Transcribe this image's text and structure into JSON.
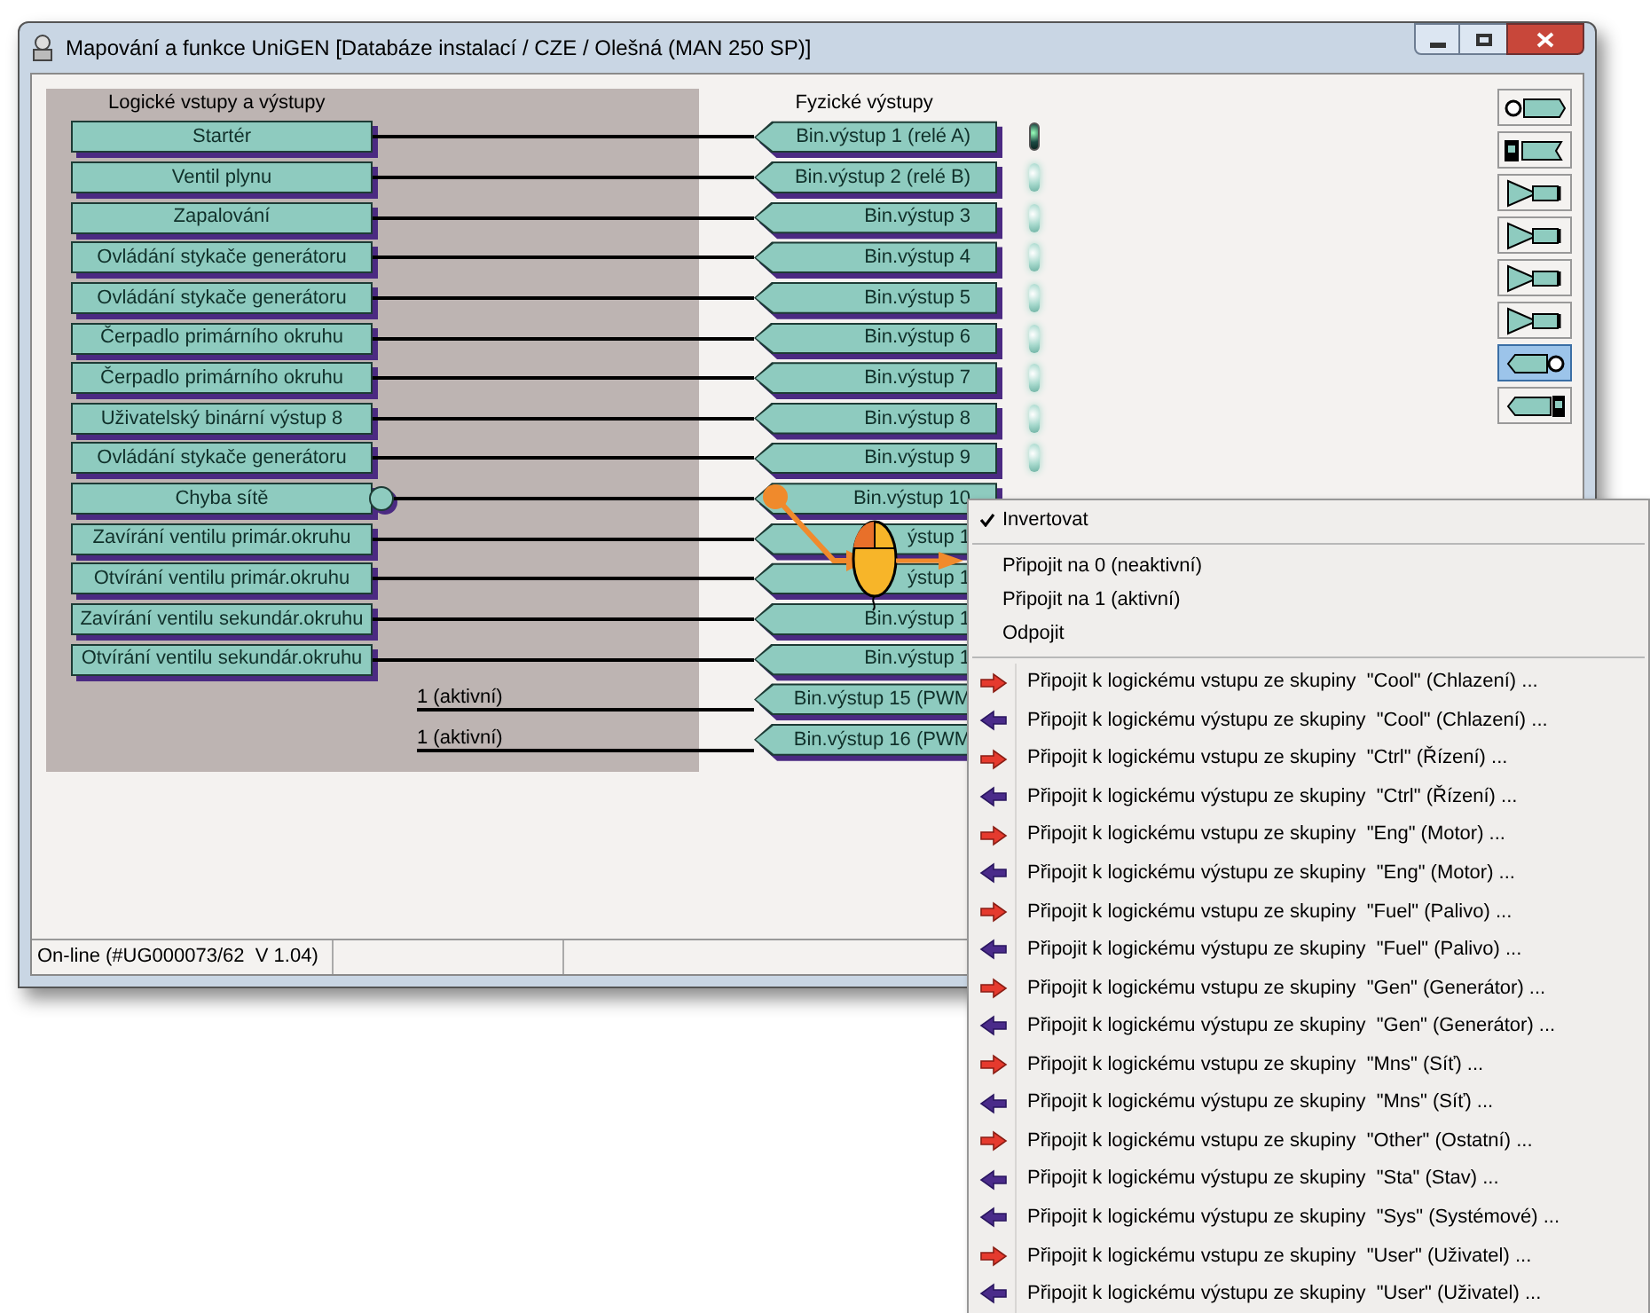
{
  "window": {
    "title": "Mapování a funkce UniGEN [Databáze instalací / CZE / Olešná (MAN 250 SP)]"
  },
  "headers": {
    "logical": "Logické vstupy a výstupy",
    "physical": "Fyzické výstupy"
  },
  "rows": [
    {
      "kind": "signal",
      "source": "Startér",
      "inverted": false,
      "output": "Bin.výstup 1 (relé A)",
      "led_on": true
    },
    {
      "kind": "signal",
      "source": "Ventil plynu",
      "inverted": false,
      "output": "Bin.výstup 2 (relé B)",
      "led_on": false
    },
    {
      "kind": "signal",
      "source": "Zapalování",
      "inverted": false,
      "output": "Bin.výstup 3",
      "led_on": false
    },
    {
      "kind": "signal",
      "source": "Ovládání stykače generátoru",
      "inverted": false,
      "output": "Bin.výstup 4",
      "led_on": false
    },
    {
      "kind": "signal",
      "source": "Ovládání stykače generátoru",
      "inverted": false,
      "output": "Bin.výstup 5",
      "led_on": false
    },
    {
      "kind": "signal",
      "source": "Čerpadlo primárního okruhu",
      "inverted": false,
      "output": "Bin.výstup 6",
      "led_on": false
    },
    {
      "kind": "signal",
      "source": "Čerpadlo primárního okruhu",
      "inverted": false,
      "output": "Bin.výstup 7",
      "led_on": false
    },
    {
      "kind": "signal",
      "source": "Uživatelský binární výstup 8",
      "inverted": false,
      "output": "Bin.výstup 8",
      "led_on": false
    },
    {
      "kind": "signal",
      "source": "Ovládání stykače generátoru",
      "inverted": false,
      "output": "Bin.výstup 9",
      "led_on": false
    },
    {
      "kind": "signal",
      "source": "Chyba sítě",
      "inverted": true,
      "output": "Bin.výstup 10"
    },
    {
      "kind": "signal",
      "source": "Zavírání ventilu primár.okruhu",
      "inverted": false,
      "output": "ýstup 1"
    },
    {
      "kind": "signal",
      "source": "Otvírání ventilu primár.okruhu",
      "inverted": false,
      "output": "ýstup 1"
    },
    {
      "kind": "signal",
      "source": "Zavírání ventilu sekundár.okruhu",
      "inverted": false,
      "output": "Bin.výstup 1"
    },
    {
      "kind": "signal",
      "source": "Otvírání ventilu sekundár.okruhu",
      "inverted": false,
      "output": "Bin.výstup 1"
    },
    {
      "kind": "constant",
      "source": "1 (aktivní)",
      "output": "Bin.výstup 15 (PWM"
    },
    {
      "kind": "constant",
      "source": "1 (aktivní)",
      "output": "Bin.výstup 16 (PWM"
    }
  ],
  "toolbar": [
    {
      "kind": "led-in",
      "selected": false
    },
    {
      "kind": "gauge",
      "selected": false
    },
    {
      "kind": "amp1",
      "selected": false
    },
    {
      "kind": "amp2",
      "selected": false
    },
    {
      "kind": "amp3",
      "selected": false
    },
    {
      "kind": "amp4",
      "selected": false
    },
    {
      "kind": "out-led",
      "selected": true
    },
    {
      "kind": "gauge-out",
      "selected": false
    }
  ],
  "status_bar": [
    "On-line (#UG000073/62  V 1.04)"
  ],
  "context_menu": {
    "items": [
      {
        "kind": "check",
        "label": "Invertovat",
        "checked": true
      },
      {
        "kind": "separator"
      },
      {
        "kind": "plain",
        "label": "Připojit na 0 (neaktivní)"
      },
      {
        "kind": "plain",
        "label": "Připojit na 1 (aktivní)"
      },
      {
        "kind": "plain",
        "label": "Odpojit"
      },
      {
        "kind": "separator"
      },
      {
        "kind": "in",
        "label": "Připojit k logickému vstupu ze skupiny  \"Cool\" (Chlazení) ..."
      },
      {
        "kind": "out",
        "label": "Připojit k logickému výstupu ze skupiny  \"Cool\" (Chlazení) ..."
      },
      {
        "kind": "in",
        "label": "Připojit k logickému vstupu ze skupiny  \"Ctrl\" (Řízení) ..."
      },
      {
        "kind": "out",
        "label": "Připojit k logickému výstupu ze skupiny  \"Ctrl\" (Řízení) ..."
      },
      {
        "kind": "in",
        "label": "Připojit k logickému vstupu ze skupiny  \"Eng\" (Motor) ..."
      },
      {
        "kind": "out",
        "label": "Připojit k logickému výstupu ze skupiny  \"Eng\" (Motor) ..."
      },
      {
        "kind": "in",
        "label": "Připojit k logickému vstupu ze skupiny  \"Fuel\" (Palivo) ..."
      },
      {
        "kind": "out",
        "label": "Připojit k logickému výstupu ze skupiny  \"Fuel\" (Palivo) ..."
      },
      {
        "kind": "in",
        "label": "Připojit k logickému vstupu ze skupiny  \"Gen\" (Generátor) ..."
      },
      {
        "kind": "out",
        "label": "Připojit k logickému výstupu ze skupiny  \"Gen\" (Generátor) ..."
      },
      {
        "kind": "in",
        "label": "Připojit k logickému vstupu ze skupiny  \"Mns\" (Síť) ..."
      },
      {
        "kind": "out",
        "label": "Připojit k logickému výstupu ze skupiny  \"Mns\" (Síť) ..."
      },
      {
        "kind": "in",
        "label": "Připojit k logickému vstupu ze skupiny  \"Other\" (Ostatní) ..."
      },
      {
        "kind": "out",
        "label": "Připojit k logickému výstupu ze skupiny  \"Sta\" (Stav) ..."
      },
      {
        "kind": "out",
        "label": "Připojit k logickému výstupu ze skupiny  \"Sys\" (Systémové) ..."
      },
      {
        "kind": "in",
        "label": "Připojit k logickému vstupu ze skupiny  \"User\" (Uživatel) ..."
      },
      {
        "kind": "out",
        "label": "Připojit k logickému výstupu ze skupiny  \"User\" (Uživatel) ..."
      }
    ]
  }
}
